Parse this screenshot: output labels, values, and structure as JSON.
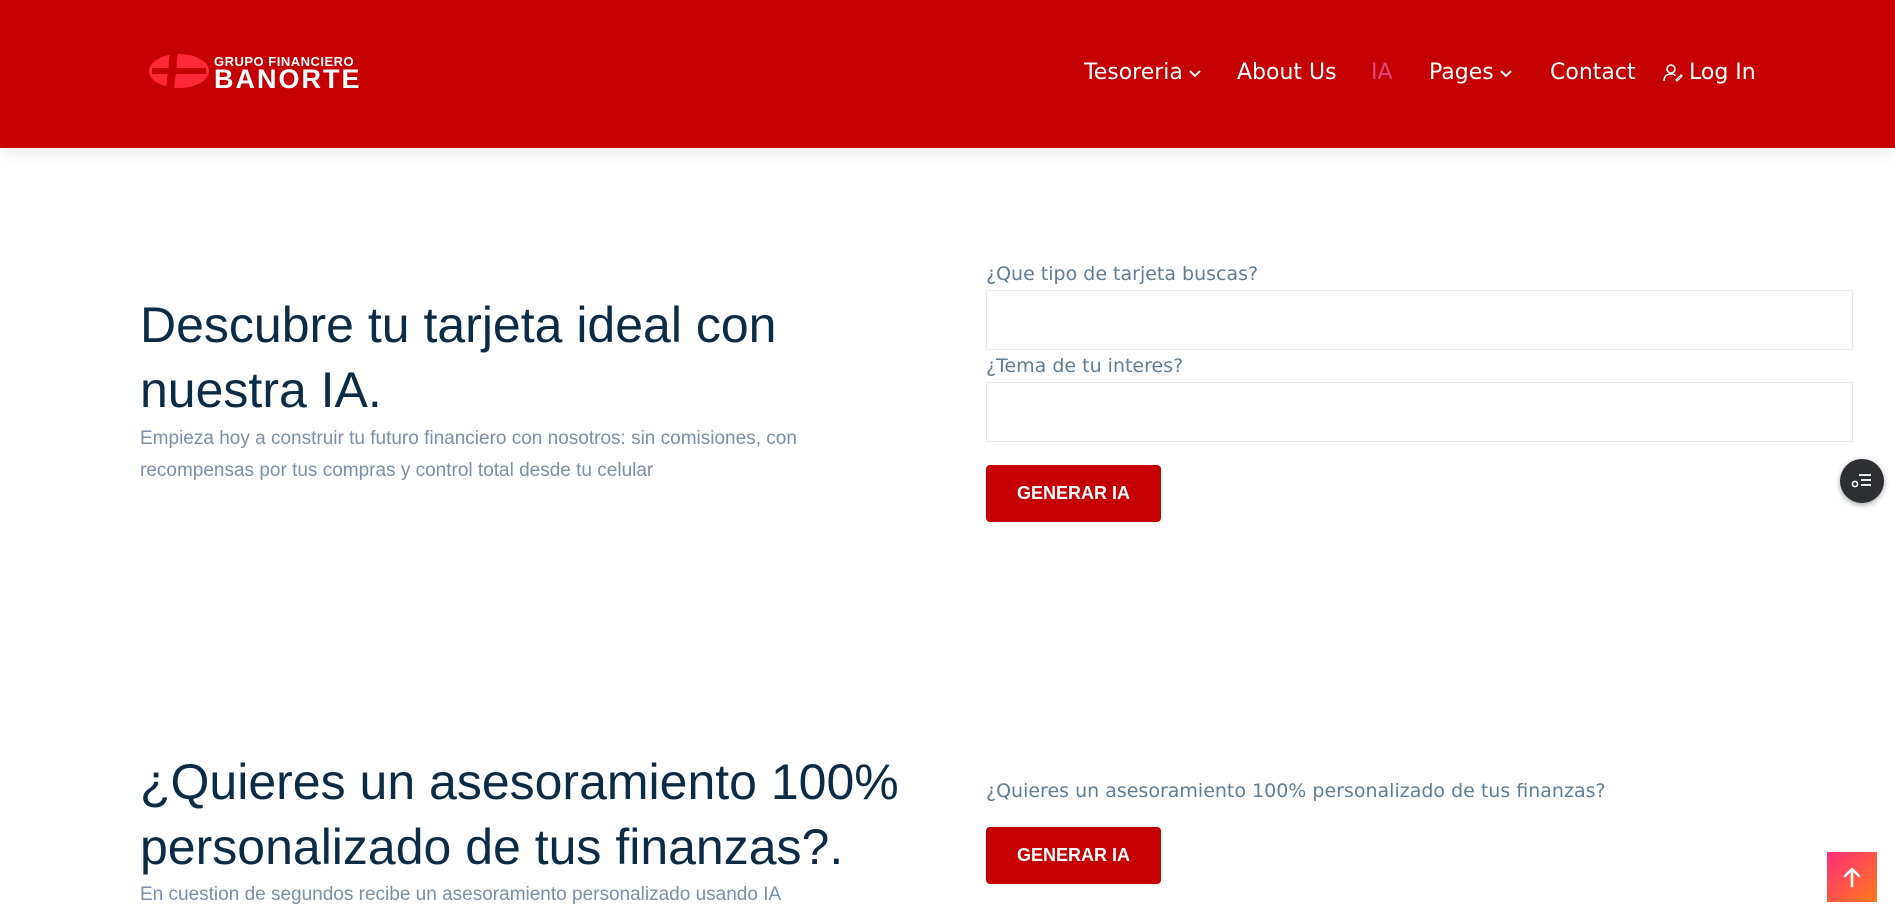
{
  "header": {
    "logo_small": "GRUPO FINANCIERO",
    "logo_big": "BANORTE",
    "nav": [
      {
        "label": "Tesoreria",
        "has_dropdown": true
      },
      {
        "label": "About Us"
      },
      {
        "label": "IA",
        "active": true
      },
      {
        "label": "Pages",
        "has_dropdown": true
      },
      {
        "label": "Contact"
      },
      {
        "label": "Log In",
        "icon": "user-icon"
      }
    ]
  },
  "section1": {
    "title": "Descubre tu tarjeta ideal con nuestra IA.",
    "subtitle": "Empieza hoy a construir tu futuro financiero con nosotros: sin comisiones, con recompensas por tus compras y control total desde tu celular",
    "field1_label": "¿Que tipo de tarjeta buscas?",
    "field1_value": "",
    "field2_label": "¿Tema de tu interes?",
    "field2_value": "",
    "button_label": "GENERAR IA"
  },
  "section2": {
    "title": "¿Quieres un asesoramiento 100% personalizado de tus finanzas?.",
    "subtitle": "En cuestion de segundos recibe un asesoramiento personalizado usando IA",
    "question": "¿Quieres un asesoramiento 100% personalizado de tus finanzas?",
    "button_label": "GENERAR IA"
  },
  "floating": {
    "menu_icon": "list-settings-icon",
    "scroll_top_icon": "arrow-up-icon"
  },
  "colors": {
    "brand_red": "#c40000",
    "heading": "#0d2b45",
    "body_text": "#7b8fa6",
    "label": "#607d94",
    "active_nav": "#e0457a"
  }
}
